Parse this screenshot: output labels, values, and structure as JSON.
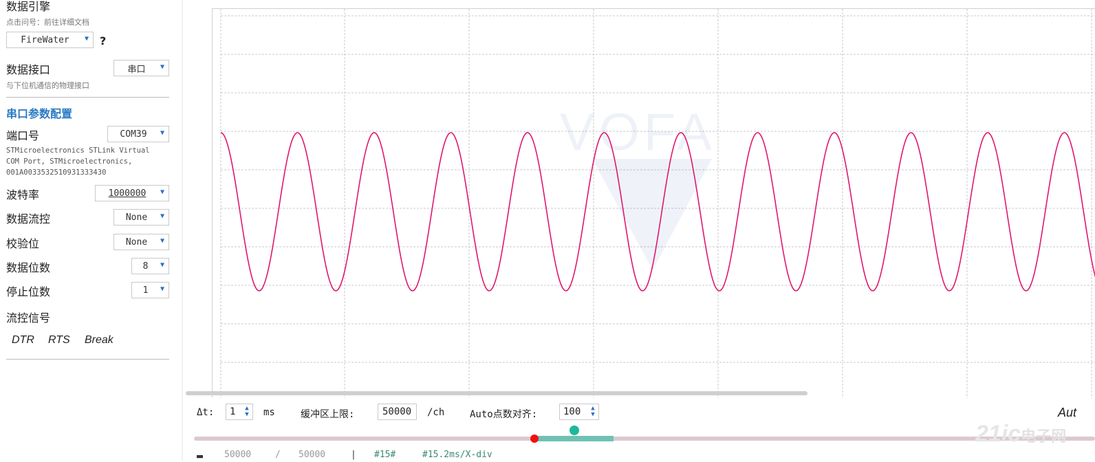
{
  "sidebar": {
    "engine_title": "数据引擎",
    "engine_sub": "点击问号：前往详细文档",
    "engine_select": "FireWater",
    "engine_help": "?",
    "interface_title": "数据接口",
    "interface_sub": "与下位机通信的物理接口",
    "interface_select": "串口",
    "serial_section": "串口参数配置",
    "port_label": "端口号",
    "port_select": "COM39",
    "port_desc_1": "STMicroelectronics STLink Virtual",
    "port_desc_2": "COM Port, STMicroelectronics,",
    "port_desc_3": "001A0033532510931333430",
    "baud_label": "波特率",
    "baud_select": "1000000",
    "flow_label": "数据流控",
    "flow_select": "None",
    "parity_label": "校验位",
    "parity_select": "None",
    "databits_label": "数据位数",
    "databits_select": "8",
    "stopbits_label": "停止位数",
    "stopbits_select": "1",
    "flow_signal_label": "流控信号",
    "dtr": "DTR",
    "rts": "RTS",
    "break": "Break"
  },
  "scope": {
    "watermark": "VOFA",
    "wave_color": "#e0166e",
    "grid_color": "#c8c8c8"
  },
  "bottom": {
    "dt_label": "Δt:",
    "dt_value": "1",
    "dt_unit": "ms",
    "buffer_label": "缓冲区上限:",
    "buffer_value": "50000",
    "buffer_unit": "/ch",
    "align_label": "Auto点数对齐:",
    "align_value": "100",
    "auto_text": "Aut",
    "status_1": "50000",
    "status_2": "/",
    "status_3": "50000",
    "status_4": "#15#",
    "status_5": "#15.2ms/X-div"
  },
  "site_watermark": {
    "main": "21ic",
    "cn": "电子网"
  }
}
